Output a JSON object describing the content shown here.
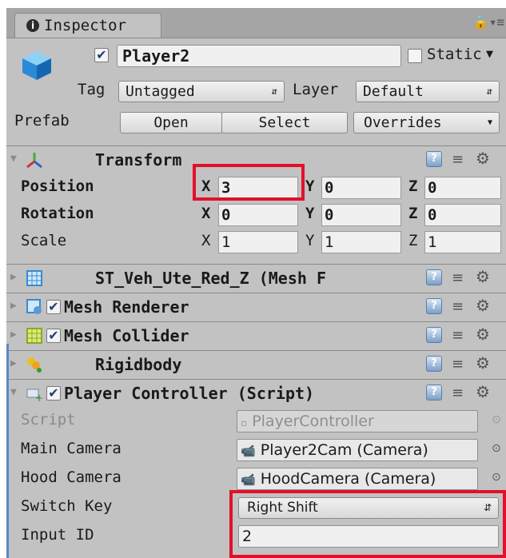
{
  "tab": {
    "title": "Inspector"
  },
  "object": {
    "name": "Player2",
    "active_checked": true,
    "static_label": "Static",
    "static_checked": false
  },
  "tag": {
    "label": "Tag",
    "value": "Untagged"
  },
  "layer": {
    "label": "Layer",
    "value": "Default"
  },
  "prefab": {
    "label": "Prefab",
    "open": "Open",
    "select": "Select",
    "overrides": "Overrides"
  },
  "transform": {
    "title": "Transform",
    "position": {
      "label": "Position",
      "x": "3",
      "y": "0",
      "z": "0"
    },
    "rotation": {
      "label": "Rotation",
      "x": "0",
      "y": "0",
      "z": "0"
    },
    "scale": {
      "label": "Scale",
      "x": "1",
      "y": "1",
      "z": "1"
    },
    "axis_x": "X",
    "axis_y": "Y",
    "axis_z": "Z"
  },
  "components": {
    "mesh_filter": "ST_Veh_Ute_Red_Z (Mesh F",
    "mesh_renderer": "Mesh Renderer",
    "mesh_collider": "Mesh Collider",
    "rigidbody": "Rigidbody",
    "player_controller": "Player Controller (Script)"
  },
  "script_fields": {
    "script": {
      "label": "Script",
      "value": "PlayerController"
    },
    "main_camera": {
      "label": "Main Camera",
      "value": "Player2Cam (Camera)"
    },
    "hood_camera": {
      "label": "Hood Camera",
      "value": "HoodCamera (Camera)"
    },
    "switch_key": {
      "label": "Switch Key",
      "value": "Right Shift"
    },
    "input_id": {
      "label": "Input ID",
      "value": "2"
    }
  },
  "colors": {
    "highlight": "#e2102a",
    "panel": "#c2c2c2",
    "tabbar": "#a5a5a5"
  }
}
